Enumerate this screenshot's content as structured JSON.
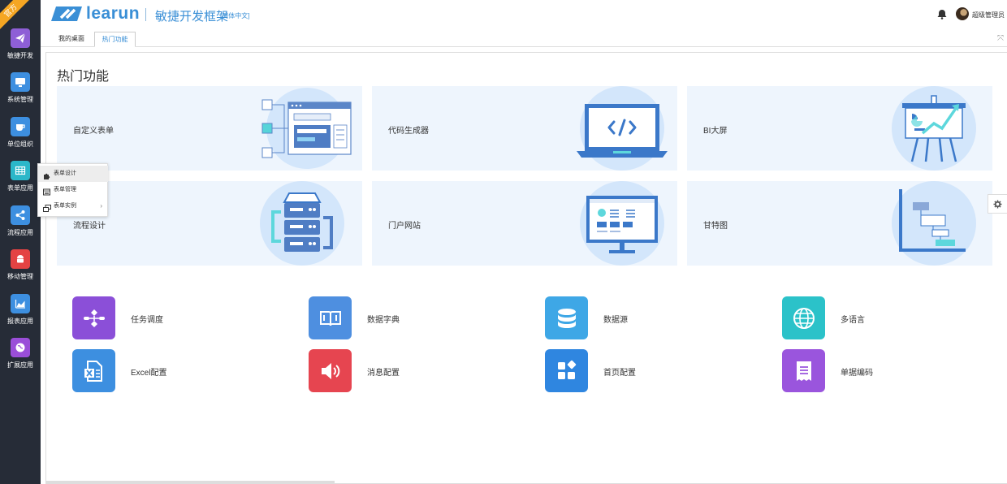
{
  "app": {
    "ribbon": "官方",
    "logo_text": "learun",
    "logo_subtitle": "敏捷开发框架",
    "logo_lang": "[简体中文]",
    "brand_color": "#3a8fd6"
  },
  "header": {
    "user_name": "超级管理员",
    "bell_icon": "bell-icon"
  },
  "sidebar": {
    "items": [
      {
        "label": "敏捷开发",
        "icon": "paper-plane-icon",
        "color": "#8e5fd6"
      },
      {
        "label": "系统管理",
        "icon": "monitor-icon",
        "color": "#3d8fe0"
      },
      {
        "label": "单位组织",
        "icon": "coffee-cup-icon",
        "color": "#3d8fe0"
      },
      {
        "label": "表单应用",
        "icon": "table-icon",
        "color": "#2bb7c9"
      },
      {
        "label": "流程应用",
        "icon": "share-icon",
        "color": "#3d8fe0"
      },
      {
        "label": "移动管理",
        "icon": "android-icon",
        "color": "#e44343"
      },
      {
        "label": "报表应用",
        "icon": "area-chart-icon",
        "color": "#3d8fe0"
      },
      {
        "label": "扩展应用",
        "icon": "globe-icon",
        "color": "#9a4ed8"
      }
    ]
  },
  "tabs": [
    {
      "label": "我的桌面"
    },
    {
      "label": "热门功能"
    }
  ],
  "popup": {
    "items": [
      {
        "label": "表单设计",
        "icon": "puzzle-icon"
      },
      {
        "label": "表单管理",
        "icon": "form-icon"
      },
      {
        "label": "表单实例",
        "icon": "window-restore-icon",
        "arrow": "›"
      }
    ]
  },
  "main": {
    "title": "热门功能",
    "cards": [
      {
        "label": "自定义表单"
      },
      {
        "label": "代码生成器"
      },
      {
        "label": "BI大屏"
      },
      {
        "label": "流程设计"
      },
      {
        "label": "门户网站"
      },
      {
        "label": "甘特图"
      }
    ],
    "features": [
      {
        "label": "任务调度",
        "icon": "flowchart-icon",
        "color": "#8b4fd8"
      },
      {
        "label": "数据字典",
        "icon": "book-icon",
        "color": "#4e8fe0"
      },
      {
        "label": "数据源",
        "icon": "database-icon",
        "color": "#3ea7e6"
      },
      {
        "label": "多语言",
        "icon": "globe-icon",
        "color": "#2bc2c9"
      },
      {
        "label": "Excel配置",
        "icon": "excel-icon",
        "color": "#3d8fe0"
      },
      {
        "label": "消息配置",
        "icon": "speaker-icon",
        "color": "#e64550"
      },
      {
        "label": "首页配置",
        "icon": "grid-blocks-icon",
        "color": "#2f86e0"
      },
      {
        "label": "单据编码",
        "icon": "receipt-icon",
        "color": "#9a55dd"
      }
    ]
  }
}
